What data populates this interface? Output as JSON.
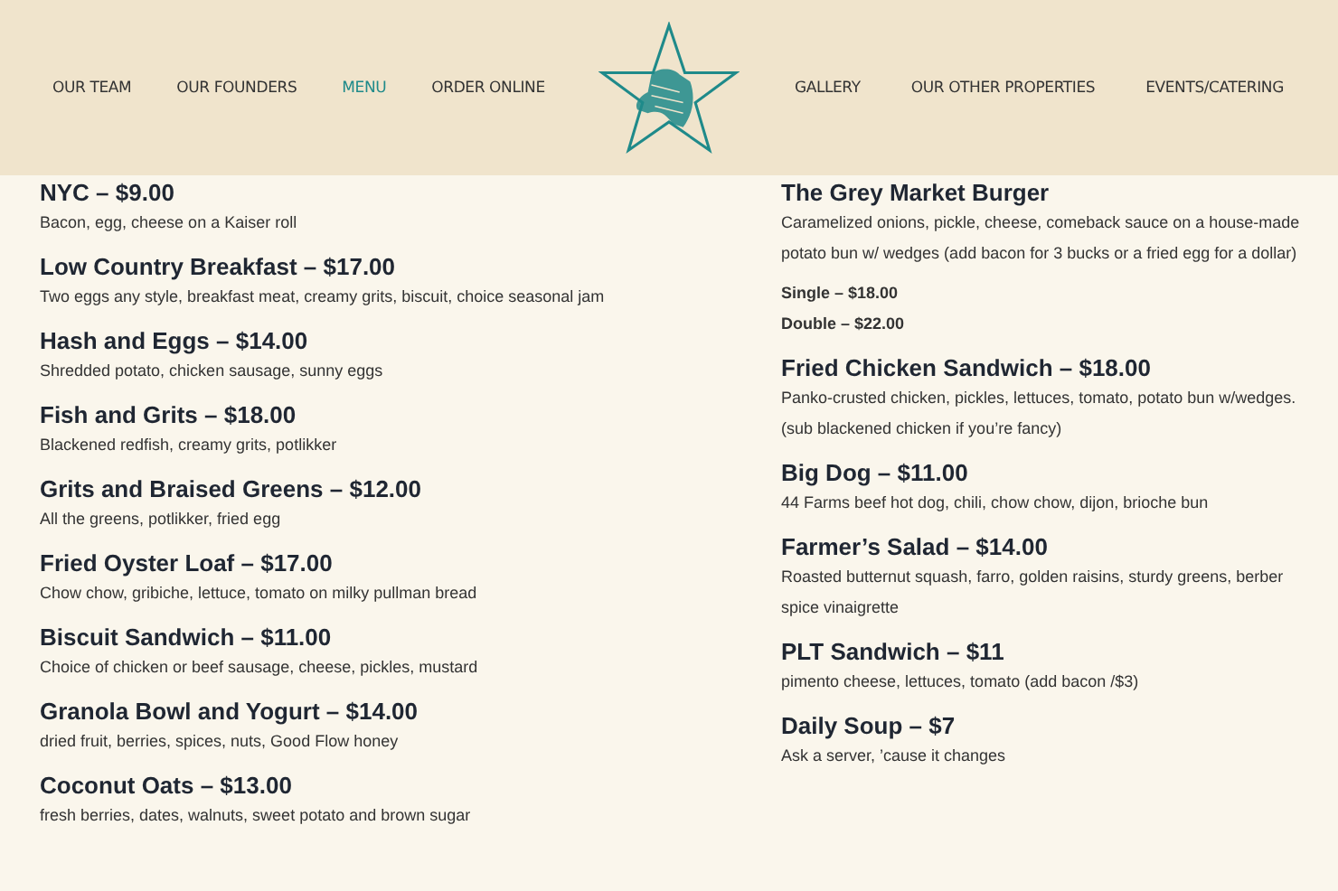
{
  "nav": {
    "left": [
      {
        "label": "OUR TEAM",
        "selected": false
      },
      {
        "label": "OUR FOUNDERS",
        "selected": false
      },
      {
        "label": "MENU",
        "selected": true
      },
      {
        "label": "ORDER ONLINE",
        "selected": false
      }
    ],
    "right": [
      {
        "label": "GALLERY",
        "selected": false
      },
      {
        "label": "OUR OTHER PROPERTIES",
        "selected": false
      },
      {
        "label": "EVENTS/CATERING",
        "selected": false
      }
    ]
  },
  "menu_columns": [
    {
      "items": [
        {
          "name": "NYC – $9.00",
          "description": "Bacon, egg, cheese on a Kaiser roll"
        },
        {
          "name": "Low Country Breakfast – $17.00",
          "description": "Two eggs any style, breakfast meat, creamy grits, biscuit, choice seasonal jam"
        },
        {
          "name": "Hash and Eggs – $14.00",
          "description": "Shredded potato, chicken sausage, sunny eggs"
        },
        {
          "name": "Fish and Grits – $18.00",
          "description": "Blackened redfish, creamy grits, potlikker"
        },
        {
          "name": "Grits and Braised Greens – $12.00",
          "description": "All the greens, potlikker, fried egg"
        },
        {
          "name": "Fried Oyster Loaf – $17.00",
          "description": "Chow chow, gribiche, lettuce, tomato on milky pullman bread"
        },
        {
          "name": "Biscuit Sandwich – $11.00",
          "description": "Choice of chicken or beef sausage, cheese, pickles, mustard"
        },
        {
          "name": "Granola Bowl and Yogurt – $14.00",
          "description": "dried fruit, berries, spices, nuts, Good Flow honey"
        },
        {
          "name": "Coconut Oats – $13.00",
          "description": "fresh berries, dates, walnuts, sweet potato and brown sugar"
        }
      ]
    },
    {
      "items": [
        {
          "name": "The Grey Market Burger",
          "description": "Caramelized onions, pickle, cheese, comeback sauce on a house-made potato bun w/ wedges (add bacon for 3 bucks or a fried egg for a dollar)",
          "prices": [
            "Single – $18.00",
            "Double – $22.00"
          ]
        },
        {
          "name": "Fried Chicken Sandwich – $18.00",
          "description": "Panko-crusted chicken, pickles, lettuces, tomato, potato bun w/wedges. (sub blackened chicken if you’re fancy)"
        },
        {
          "name": "Big Dog – $11.00",
          "description": "44 Farms beef hot dog, chili, chow chow, dijon, brioche bun"
        },
        {
          "name": "Farmer’s Salad – $14.00",
          "description": "Roasted butternut squash, farro, golden raisins, sturdy greens, berber spice vinaigrette"
        },
        {
          "name": "PLT Sandwich – $11",
          "description": "pimento cheese, lettuces, tomato (add bacon /$3)"
        },
        {
          "name": "Daily Soup – $7",
          "description": "Ask a server, ’cause it changes"
        }
      ]
    }
  ]
}
